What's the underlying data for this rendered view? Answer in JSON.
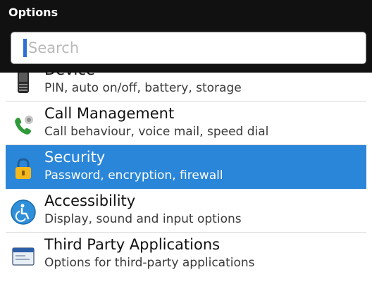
{
  "header": {
    "title": "Options"
  },
  "search": {
    "placeholder": "Search",
    "value": ""
  },
  "list": {
    "items": [
      {
        "id": "device",
        "title": "Device",
        "subtitle": "PIN, auto on/off, battery, storage",
        "icon": "device-icon",
        "selected": false
      },
      {
        "id": "call-management",
        "title": "Call Management",
        "subtitle": "Call behaviour, voice mail, speed dial",
        "icon": "phone-icon",
        "selected": false
      },
      {
        "id": "security",
        "title": "Security",
        "subtitle": "Password, encryption, firewall",
        "icon": "lock-icon",
        "selected": true
      },
      {
        "id": "accessibility",
        "title": "Accessibility",
        "subtitle": "Display, sound and input options",
        "icon": "accessibility-icon",
        "selected": false
      },
      {
        "id": "third-party",
        "title": "Third Party Applications",
        "subtitle": "Options for third-party applications",
        "icon": "app-window-icon",
        "selected": false
      }
    ]
  },
  "colors": {
    "header_bg": "#111111",
    "selection": "#2a86d8",
    "cursor": "#2f6fd6"
  },
  "icons": {
    "scroll": "scroll-up-arrow-icon"
  }
}
